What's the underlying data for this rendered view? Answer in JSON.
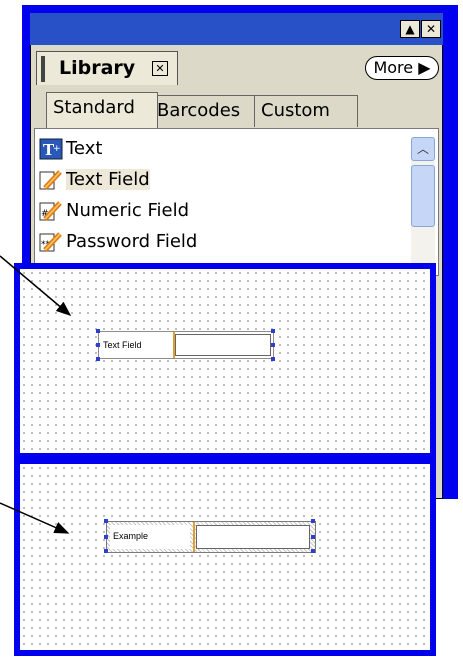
{
  "palette": {
    "window_buttons": {
      "up": "▲",
      "close": "✕"
    },
    "panel_tab": {
      "title": "Library",
      "close_glyph": "✕"
    },
    "more_button": "More",
    "tabs": [
      "Standard",
      "Barcodes",
      "Custom"
    ],
    "items": [
      {
        "label": "Text",
        "icon": "text-tool-icon"
      },
      {
        "label": "Text Field",
        "icon": "pencil-field-icon"
      },
      {
        "label": "Numeric Field",
        "icon": "numeric-field-icon"
      },
      {
        "label": "Password Field",
        "icon": "password-field-icon"
      }
    ],
    "scrollbar": {
      "up_glyph": "︿"
    }
  },
  "canvas_top": {
    "field_label": "Text Field"
  },
  "canvas_bottom": {
    "field_label": "Example"
  },
  "colors": {
    "frame": "#0000ee",
    "titlebar": "#2851c8",
    "arrow": "#000000",
    "divider": "#e0a030"
  }
}
